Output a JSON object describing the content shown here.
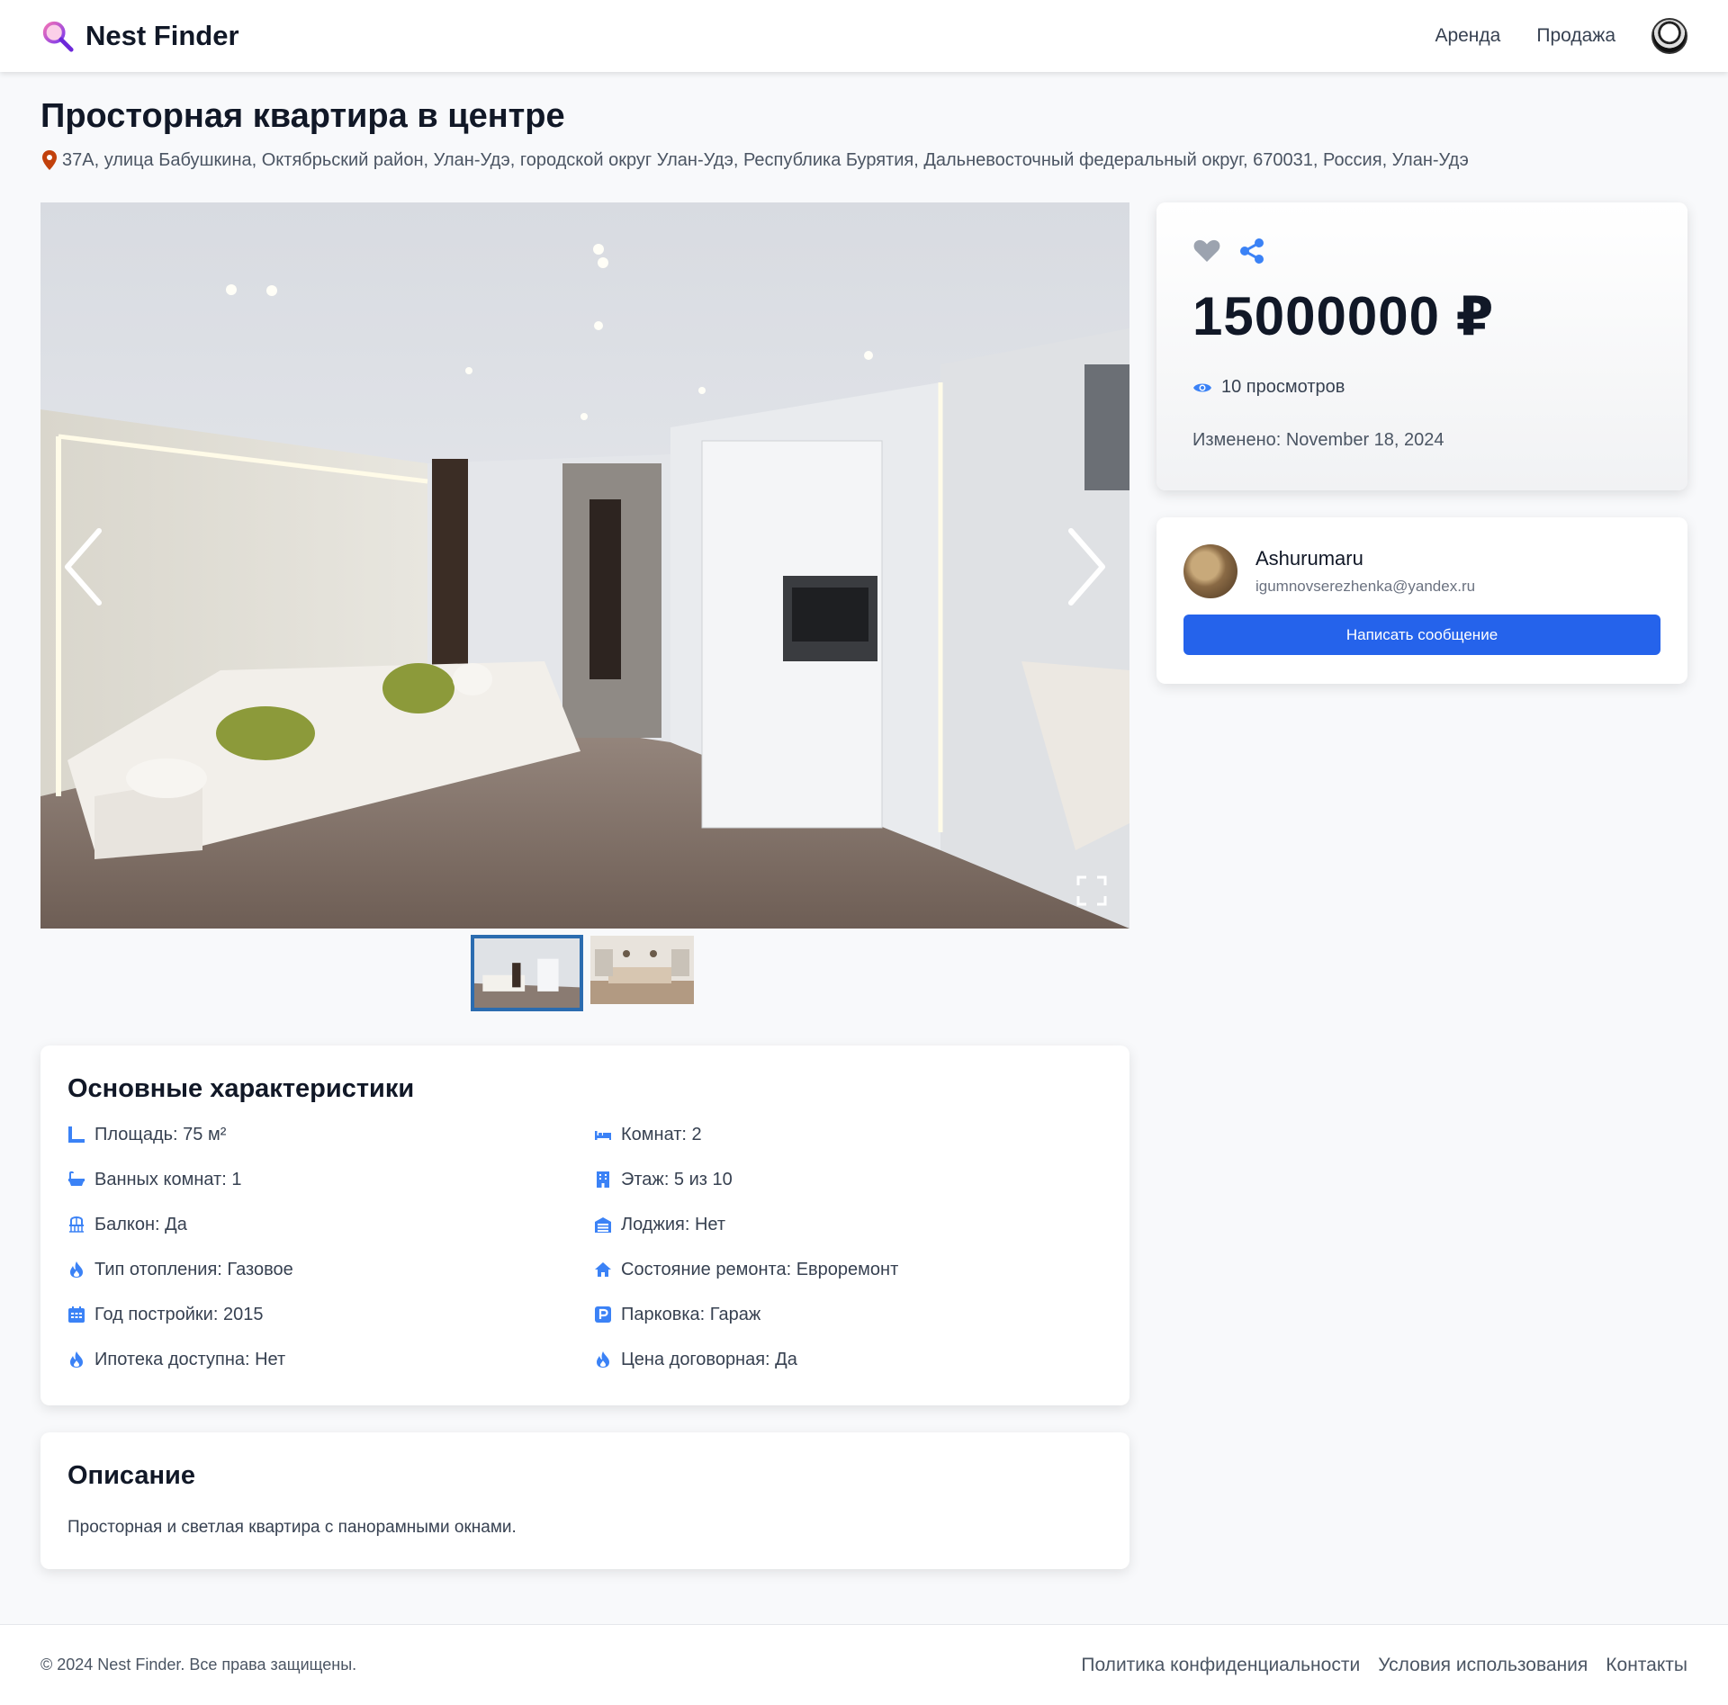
{
  "header": {
    "brand": "Nest Finder",
    "nav": {
      "rent": "Аренда",
      "sale": "Продажа"
    }
  },
  "listing": {
    "title": "Просторная квартира в центре",
    "address": "37А, улица Бабушкина, Октябрьский район, Улан-Удэ, городской округ Улан-Удэ, Республика Бурятия, Дальневосточный федеральный округ, 670031, Россия, Улан-Удэ",
    "price": "15000000 ₽",
    "views": "10 просмотров",
    "modified": "Изменено: November 18, 2024"
  },
  "gallery": {
    "image_count": 2,
    "active_index": 0
  },
  "seller": {
    "name": "Ashurumaru",
    "email": "igumnovserezhenka@yandex.ru",
    "message_button": "Написать сообщение"
  },
  "features": {
    "title": "Основные характеристики",
    "items": [
      {
        "icon": "ruler-icon",
        "text": "Площадь: 75 м²"
      },
      {
        "icon": "bed-icon",
        "text": "Комнат: 2"
      },
      {
        "icon": "bath-icon",
        "text": "Ванных комнат: 1"
      },
      {
        "icon": "building-icon",
        "text": "Этаж: 5 из 10"
      },
      {
        "icon": "balcony-icon",
        "text": "Балкон: Да"
      },
      {
        "icon": "warehouse-icon",
        "text": "Лоджия: Нет"
      },
      {
        "icon": "flame-icon",
        "text": "Тип отопления: Газовое"
      },
      {
        "icon": "home-icon",
        "text": "Состояние ремонта: Евроремонт"
      },
      {
        "icon": "calendar-icon",
        "text": "Год постройки: 2015"
      },
      {
        "icon": "parking-icon",
        "text": "Парковка: Гараж"
      },
      {
        "icon": "flame-icon",
        "text": "Ипотека доступна: Нет"
      },
      {
        "icon": "flame-icon",
        "text": "Цена договорная: Да"
      }
    ]
  },
  "description": {
    "title": "Описание",
    "text": "Просторная и светлая квартира с панорамными окнами."
  },
  "footer": {
    "copyright": "© 2024 Nest Finder. Все права защищены.",
    "links": {
      "privacy": "Политика конфиденциальности",
      "terms": "Условия использования",
      "contacts": "Контакты"
    }
  },
  "colors": {
    "accent": "#2563eb",
    "icon_blue": "#3b82f6",
    "pin": "#c2410c",
    "heart": "#9ca3af"
  }
}
